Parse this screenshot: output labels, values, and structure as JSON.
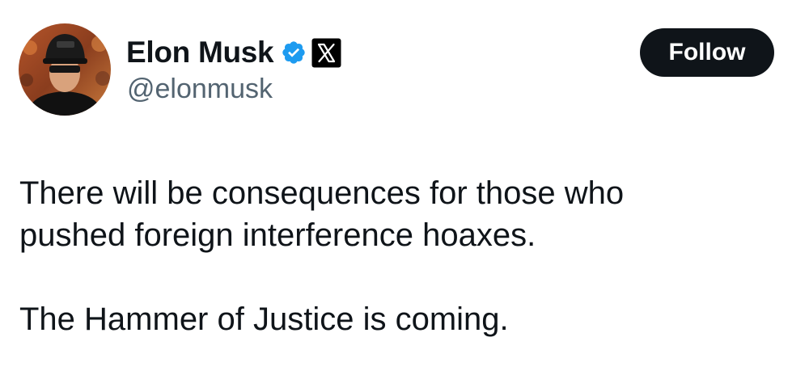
{
  "author": {
    "display_name": "Elon Musk",
    "handle": "@elonmusk",
    "verified_badge_icon": "verified-check-icon",
    "verified_badge_color": "#1d9bf0",
    "affiliate_badge_icon": "x-logo-icon",
    "avatar_icon": "profile-photo"
  },
  "actions": {
    "follow_label": "Follow"
  },
  "tweet": {
    "lines": [
      "There will be consequences for those who",
      "pushed foreign interference hoaxes.",
      "The Hammer of Justice is coming."
    ]
  },
  "colors": {
    "text": "#0f1419",
    "secondary_text": "#536471",
    "button_bg": "#0f1419",
    "button_text": "#ffffff",
    "background": "#ffffff"
  }
}
